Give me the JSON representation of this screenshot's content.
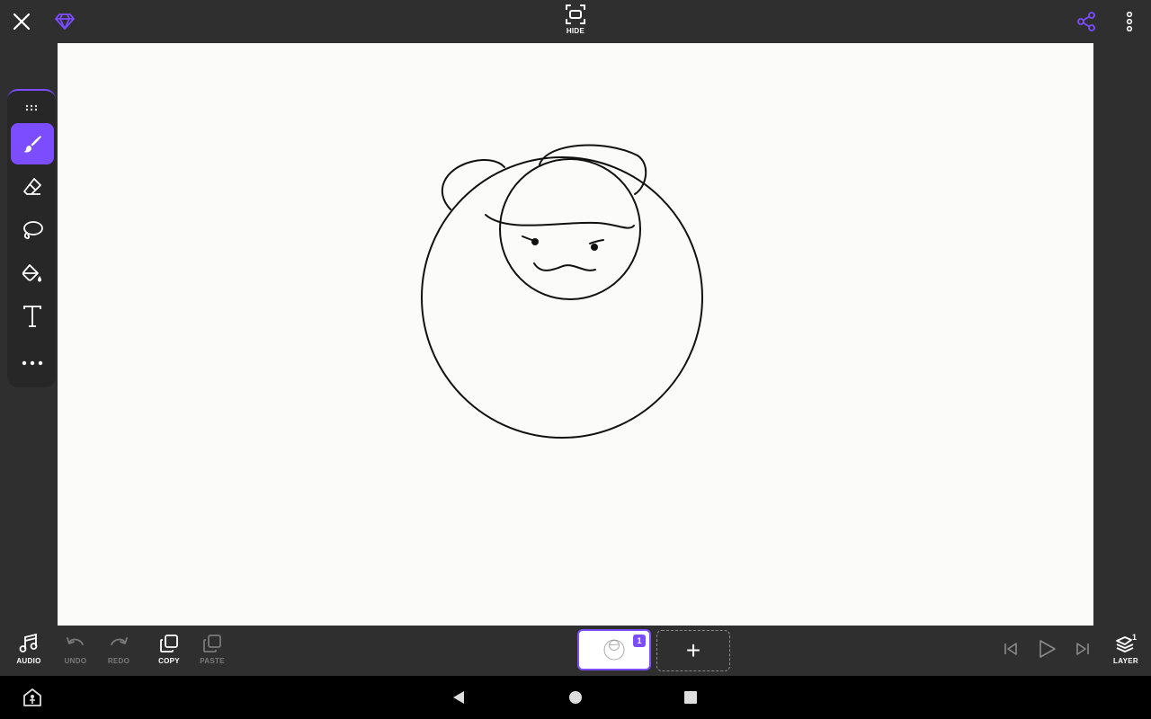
{
  "topbar": {
    "hide_label": "HIDE"
  },
  "toolbar": {
    "tools": [
      "brush",
      "eraser",
      "lasso",
      "fill",
      "text",
      "more"
    ],
    "active_tool": "brush"
  },
  "bottombar": {
    "audio_label": "AUDIO",
    "undo_label": "UNDO",
    "redo_label": "REDO",
    "copy_label": "COPY",
    "paste_label": "PASTE",
    "layer_label": "LAYER",
    "layer_count": "1",
    "frame_number": "1",
    "add_frame_symbol": "+"
  },
  "colors": {
    "accent": "#7c4dff",
    "bar_bg": "#2f2f2f",
    "canvas_bg": "#fbfbfa",
    "disabled_text": "#7a7a7a"
  }
}
